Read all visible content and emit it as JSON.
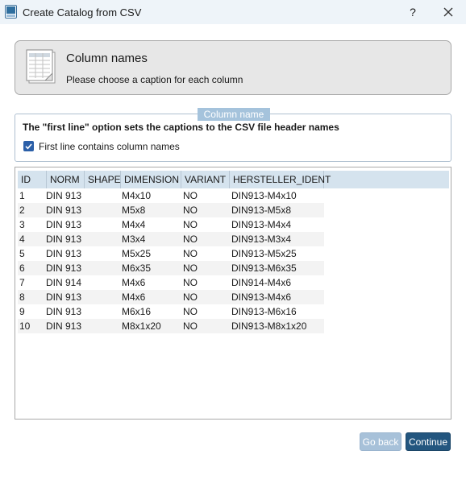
{
  "window": {
    "title": "Create Catalog from CSV",
    "help_label": "?"
  },
  "header": {
    "title": "Column names",
    "subtitle": "Please choose a caption for each column"
  },
  "tooltip": "Column name",
  "info": {
    "text": "The \"first line\" option sets the captions to the CSV file header names",
    "checkbox_label": "First line contains column names",
    "checkbox_checked": true
  },
  "table": {
    "columns": [
      "ID",
      "NORM",
      "SHAPE",
      "DIMENSION",
      "VARIANT",
      "HERSTELLER_IDENT"
    ],
    "rows": [
      [
        "1",
        "DIN 913",
        "",
        "M4x10",
        "NO",
        "DIN913-M4x10"
      ],
      [
        "2",
        "DIN 913",
        "",
        "M5x8",
        "NO",
        "DIN913-M5x8"
      ],
      [
        "3",
        "DIN 913",
        "",
        "M4x4",
        "NO",
        "DIN913-M4x4"
      ],
      [
        "4",
        "DIN 913",
        "",
        "M3x4",
        "NO",
        "DIN913-M3x4"
      ],
      [
        "5",
        "DIN 913",
        "",
        "M5x25",
        "NO",
        "DIN913-M5x25"
      ],
      [
        "6",
        "DIN 913",
        "",
        "M6x35",
        "NO",
        "DIN913-M6x35"
      ],
      [
        "7",
        "DIN 914",
        "",
        "M4x6",
        "NO",
        "DIN914-M4x6"
      ],
      [
        "8",
        "DIN 913",
        "",
        "M4x6",
        "NO",
        "DIN913-M4x6"
      ],
      [
        "9",
        "DIN 913",
        "",
        "M6x16",
        "NO",
        "DIN913-M6x16"
      ],
      [
        "10",
        "DIN 913",
        "",
        "M8x1x20",
        "NO",
        "DIN913-M8x1x20"
      ]
    ]
  },
  "buttons": {
    "back_label": "Go back",
    "continue_label": "Continue"
  },
  "colors": {
    "accent": "#23567f",
    "disabled": "#a7c1d9",
    "header_bg": "#d5e3ee",
    "checkbox": "#2b5fa8"
  }
}
